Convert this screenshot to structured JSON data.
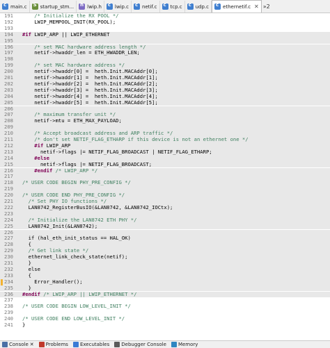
{
  "tabs": [
    {
      "label": "main.c",
      "icon": "c-file-icon",
      "active": false
    },
    {
      "label": "startup_stm...",
      "icon": "asm-file-icon",
      "active": false
    },
    {
      "label": "lwip.h",
      "icon": "header-file-icon",
      "active": false
    },
    {
      "label": "lwip.c",
      "icon": "c-file-icon",
      "active": false
    },
    {
      "label": "netif.c",
      "icon": "c-file-icon",
      "active": false
    },
    {
      "label": "tcp.c",
      "icon": "c-file-icon",
      "active": false
    },
    {
      "label": "udp.c",
      "icon": "c-file-icon",
      "active": false
    },
    {
      "label": "ethernetif.c",
      "icon": "c-file-icon",
      "active": true
    }
  ],
  "tab_close_glyph": "✕",
  "tab_overflow": "»2",
  "code": [
    {
      "n": "191",
      "t": "    /* Initialize the RX POOL */",
      "shade": false
    },
    {
      "n": "192",
      "t": "    LWIP_MEMPOOL_INIT(RX_POOL);",
      "shade": false
    },
    {
      "n": "193",
      "t": "",
      "shade": false
    },
    {
      "n": "194",
      "t": "#if LWIP_ARP || LWIP_ETHERNET",
      "shade": true
    },
    {
      "n": "195",
      "t": "",
      "shade": true
    },
    {
      "n": "196",
      "t": "    /* set MAC hardware address length */",
      "shade": true
    },
    {
      "n": "197",
      "t": "    netif->hwaddr_len = ETH_HWADDR_LEN;",
      "shade": true
    },
    {
      "n": "198",
      "t": "",
      "shade": true
    },
    {
      "n": "199",
      "t": "    /* set MAC hardware address */",
      "shade": true
    },
    {
      "n": "200",
      "t": "    netif->hwaddr[0] =  heth.Init.MACAddr[0];",
      "shade": true
    },
    {
      "n": "201",
      "t": "    netif->hwaddr[1] =  heth.Init.MACAddr[1];",
      "shade": true
    },
    {
      "n": "202",
      "t": "    netif->hwaddr[2] =  heth.Init.MACAddr[2];",
      "shade": true
    },
    {
      "n": "203",
      "t": "    netif->hwaddr[3] =  heth.Init.MACAddr[3];",
      "shade": true
    },
    {
      "n": "204",
      "t": "    netif->hwaddr[4] =  heth.Init.MACAddr[4];",
      "shade": true
    },
    {
      "n": "205",
      "t": "    netif->hwaddr[5] =  heth.Init.MACAddr[5];",
      "shade": true
    },
    {
      "n": "206",
      "t": "",
      "shade": true
    },
    {
      "n": "207",
      "t": "    /* maximum transfer unit */",
      "shade": true
    },
    {
      "n": "208",
      "t": "    netif->mtu = ETH_MAX_PAYLOAD;",
      "shade": true
    },
    {
      "n": "209",
      "t": "",
      "shade": true
    },
    {
      "n": "210",
      "t": "    /* Accept broadcast address and ARP traffic */",
      "shade": true
    },
    {
      "n": "211",
      "t": "    /* don't set NETIF_FLAG_ETHARP if this device is not an ethernet one */",
      "shade": true
    },
    {
      "n": "212",
      "t": "    #if LWIP_ARP",
      "shade": true
    },
    {
      "n": "213",
      "t": "      netif->flags |= NETIF_FLAG_BROADCAST | NETIF_FLAG_ETHARP;",
      "shade": true
    },
    {
      "n": "214",
      "t": "    #else",
      "shade": true
    },
    {
      "n": "215",
      "t": "      netif->flags |= NETIF_FLAG_BROADCAST;",
      "shade": true
    },
    {
      "n": "216",
      "t": "    #endif /* LWIP_ARP */",
      "shade": true
    },
    {
      "n": "217",
      "t": "",
      "shade": true
    },
    {
      "n": "218",
      "t": "/* USER CODE BEGIN PHY_PRE_CONFIG */",
      "shade": true
    },
    {
      "n": "219",
      "t": "",
      "shade": true
    },
    {
      "n": "220",
      "t": "/* USER CODE END PHY_PRE_CONFIG */",
      "shade": true
    },
    {
      "n": "221",
      "t": "  /* Set PHY IO functions */",
      "shade": true
    },
    {
      "n": "222",
      "t": "  LAN8742_RegisterBusIO(&LAN8742, &LAN8742_IOCtx);",
      "shade": true
    },
    {
      "n": "223",
      "t": "",
      "shade": true
    },
    {
      "n": "224",
      "t": "  /* Initialize the LAN8742 ETH PHY */",
      "shade": true
    },
    {
      "n": "225",
      "t": "  LAN8742_Init(&LAN8742);",
      "shade": true
    },
    {
      "n": "226",
      "t": "",
      "shade": true
    },
    {
      "n": "227",
      "t": "  if (hal_eth_init_status == HAL_OK)",
      "shade": true
    },
    {
      "n": "228",
      "t": "  {",
      "shade": true
    },
    {
      "n": "229",
      "t": "  /* Get link state */",
      "shade": true
    },
    {
      "n": "230",
      "t": "  ethernet_link_check_state(netif);",
      "shade": true
    },
    {
      "n": "231",
      "t": "  }",
      "shade": true
    },
    {
      "n": "232",
      "t": "  else",
      "shade": true
    },
    {
      "n": "233",
      "t": "  {",
      "shade": true
    },
    {
      "n": "234",
      "t": "    Error_Handler();",
      "shade": true,
      "marker": true
    },
    {
      "n": "235",
      "t": "  }",
      "shade": true
    },
    {
      "n": "236",
      "t": "#endif /* LWIP_ARP || LWIP_ETHERNET */",
      "shade": true
    },
    {
      "n": "237",
      "t": "",
      "shade": false
    },
    {
      "n": "238",
      "t": "/* USER CODE BEGIN LOW_LEVEL_INIT */",
      "shade": false
    },
    {
      "n": "239",
      "t": "",
      "shade": false
    },
    {
      "n": "240",
      "t": "/* USER CODE END LOW_LEVEL_INIT */",
      "shade": false
    },
    {
      "n": "241",
      "t": "}",
      "shade": false
    }
  ],
  "bottom_tabs": [
    {
      "label": "Console",
      "icon": "console-icon",
      "color": "#4a6fa5",
      "close": "✕"
    },
    {
      "label": "Problems",
      "icon": "problems-icon",
      "color": "#c0392b"
    },
    {
      "label": "Executables",
      "icon": "executables-icon",
      "color": "#3a7bd5"
    },
    {
      "label": "Debugger Console",
      "icon": "debugger-console-icon",
      "color": "#5a5a5a"
    },
    {
      "label": "Memory",
      "icon": "memory-icon",
      "color": "#2e86c1"
    }
  ],
  "colors": {
    "comment": "#3f7f5f",
    "preprocessor": "#7f0055",
    "shaded_bg": "#e8e8e8",
    "breakpoint_marker": "#f2b230"
  }
}
